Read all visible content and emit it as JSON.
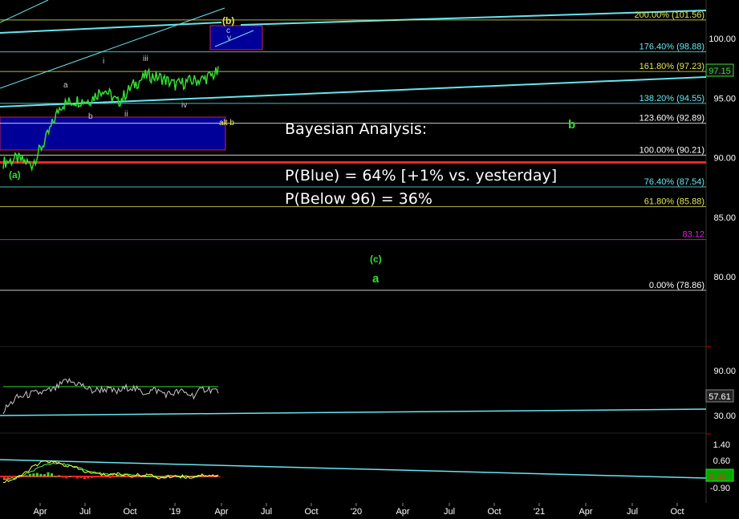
{
  "colors": {
    "background": "#000000",
    "price": "#33dd33",
    "channel": "#66e6f0",
    "support": "#ff2222",
    "zone": "#000099",
    "zone_border": "#cc2244",
    "fib_magenta": "#dd22dd",
    "rsi": "#c8c8c8",
    "macd_fast": "#ffff44",
    "macd_slow": "#44ff44",
    "hist_red": "#ff2222",
    "hist_green": "#33dd33",
    "axis_text": "#ffffff",
    "wave_text": "#c8c8d8",
    "wave_green": "#33dd33",
    "wave_yellow": "#f0f060"
  },
  "analysis": {
    "title": "Bayesian Analysis:",
    "p_blue": "P(Blue) = 64% [+1% vs. yesterday]",
    "p_below": "P(Below 96) = 36%"
  },
  "wave_labels": {
    "b_top": "(b)",
    "c_top": "c",
    "v_top": "v",
    "alt_b": "alt b",
    "a_paren": "(a)",
    "big_b": "b",
    "c_paren": "(c)",
    "big_a": "a",
    "minor": [
      "a",
      "b",
      "i",
      "ii",
      "iii",
      "iv"
    ]
  },
  "chart_data": {
    "type": "line",
    "title": "",
    "price_panel": {
      "y_ticks": [
        "100.00",
        "95.00",
        "90.00",
        "85.00",
        "80.00"
      ],
      "ylim": [
        77.0,
        103.0
      ],
      "last_price": "97.15",
      "series": [
        {
          "date": "2018-01",
          "value": 89.6
        },
        {
          "date": "2018-02",
          "value": 89.9
        },
        {
          "date": "2018-03",
          "value": 89.4
        },
        {
          "date": "2018-04",
          "value": 91.6
        },
        {
          "date": "2018-05",
          "value": 94.4
        },
        {
          "date": "2018-06",
          "value": 94.8
        },
        {
          "date": "2018-07",
          "value": 94.8
        },
        {
          "date": "2018-08",
          "value": 95.8
        },
        {
          "date": "2018-09",
          "value": 94.6
        },
        {
          "date": "2018-10",
          "value": 96.0
        },
        {
          "date": "2018-11",
          "value": 96.9
        },
        {
          "date": "2018-12",
          "value": 96.7
        },
        {
          "date": "2019-01",
          "value": 96.1
        },
        {
          "date": "2019-02",
          "value": 96.4
        },
        {
          "date": "2019-03",
          "value": 96.6
        },
        {
          "date": "2019-03-29",
          "value": 97.15
        }
      ],
      "fib_levels": [
        {
          "label": "200.00% (101.56)",
          "value": 101.56,
          "color": "#e6e650"
        },
        {
          "label": "176.40% (98.88)",
          "value": 98.88,
          "color": "#66e6f0"
        },
        {
          "label": "161.80% (97.23)",
          "value": 97.23,
          "color": "#e6e650"
        },
        {
          "label": "138.20% (94.55)",
          "value": 94.55,
          "color": "#66e6f0"
        },
        {
          "label": "123.60% (92.89)",
          "value": 92.89,
          "color": "#ffffff"
        },
        {
          "label": "100.00% (90.21)",
          "value": 90.21,
          "color": "#ffffff"
        },
        {
          "label": "76.40% (87.54)",
          "value": 87.54,
          "color": "#66e6f0"
        },
        {
          "label": "61.80% (85.88)",
          "value": 85.88,
          "color": "#e6e650"
        },
        {
          "label": "83.12",
          "value": 83.12,
          "color": "#dd22dd"
        },
        {
          "label": "0.00% (78.86)",
          "value": 78.86,
          "color": "#ffffff"
        }
      ],
      "support_line": 89.6
    },
    "rsi_panel": {
      "y_ticks": [
        "90.00",
        "30.00"
      ],
      "ylim": [
        0,
        100
      ],
      "last_value": "57.61",
      "values": [
        22,
        45,
        52,
        55,
        60,
        76,
        71,
        58,
        62,
        56,
        66,
        55,
        60,
        52,
        57,
        50,
        63,
        57.61
      ]
    },
    "macd_panel": {
      "y_ticks": [
        "1.40",
        "0.60",
        "0.20",
        "-0.90"
      ],
      "ylim": [
        -1.2,
        1.8
      ],
      "last_value": "0.03",
      "fast": [
        -0.3,
        -0.1,
        0.5,
        0.9,
        0.7,
        0.5,
        0.2,
        0.1,
        0.15,
        0.05,
        0.1,
        -0.1,
        0.05,
        -0.05,
        0.1,
        0.03
      ],
      "slow": [
        -0.2,
        -0.05,
        0.3,
        0.7,
        0.75,
        0.55,
        0.3,
        0.15,
        0.12,
        0.08,
        0.06,
        0.0,
        0.02,
        0.0,
        0.05,
        0.04
      ]
    },
    "x_ticks": [
      "Apr",
      "Jul",
      "Oct",
      "'19",
      "Apr",
      "Jul",
      "Oct",
      "'20",
      "Apr",
      "Jul",
      "Oct",
      "'21",
      "Apr",
      "Jul",
      "Oct"
    ]
  }
}
